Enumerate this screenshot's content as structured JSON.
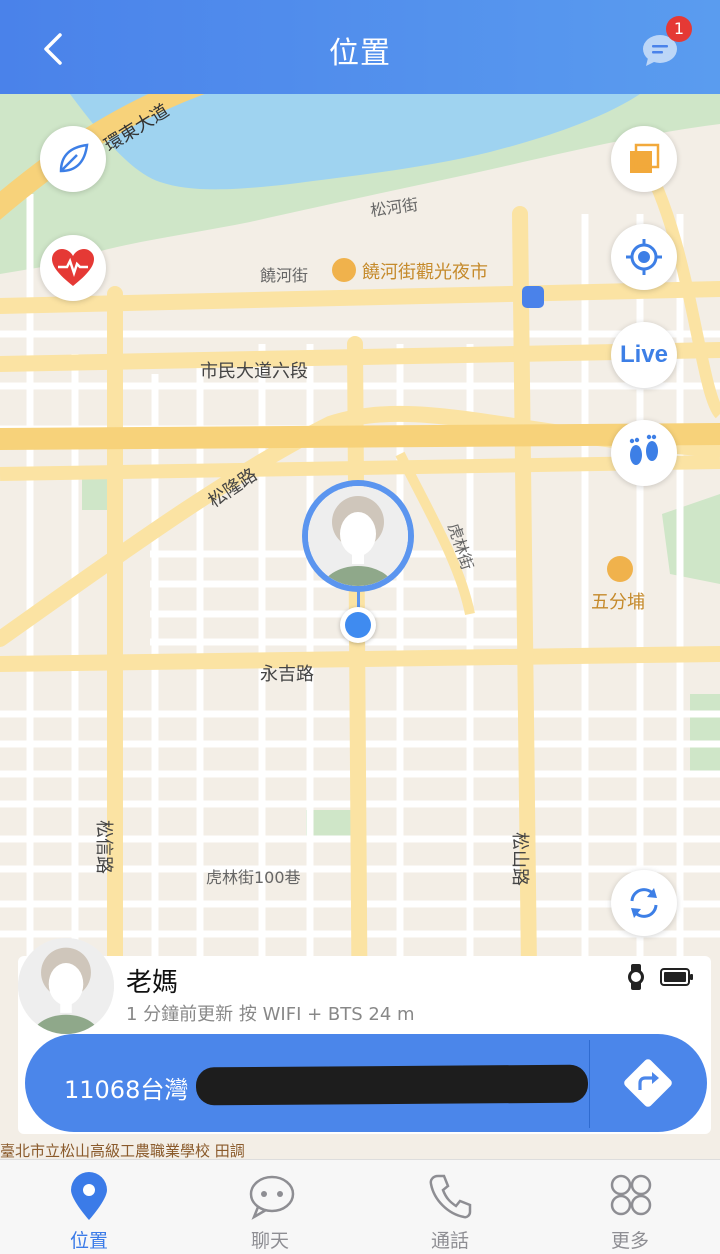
{
  "header": {
    "title": "位置",
    "badge_count": "1"
  },
  "map": {
    "labels": {
      "huandong": "環東大道",
      "songhe": "松河街",
      "raohe": "饒河街",
      "raohe_market": "饒河街觀光夜市",
      "shimin": "市民大道六段",
      "songlong": "松隆路",
      "hulin": "虎林街",
      "wufenpu": "五分埔",
      "yongji": "永吉路",
      "songxin": "松信路",
      "songshan": "松山路",
      "hulin100": "虎林街100巷"
    },
    "live_label": "Live"
  },
  "device": {
    "name": "老媽",
    "status": "1 分鐘前更新 按 WIFI + BTS 24 m",
    "address": "11068台灣"
  },
  "bottom_strip": "臺北市立松山高級工農職業學校                    田調",
  "tabs": [
    {
      "label": "位置"
    },
    {
      "label": "聊天"
    },
    {
      "label": "通話"
    },
    {
      "label": "更多"
    }
  ],
  "colors": {
    "accent": "#4a82ea",
    "badge": "#e53935",
    "heart": "#e53935",
    "poi": "#c58a2b"
  }
}
